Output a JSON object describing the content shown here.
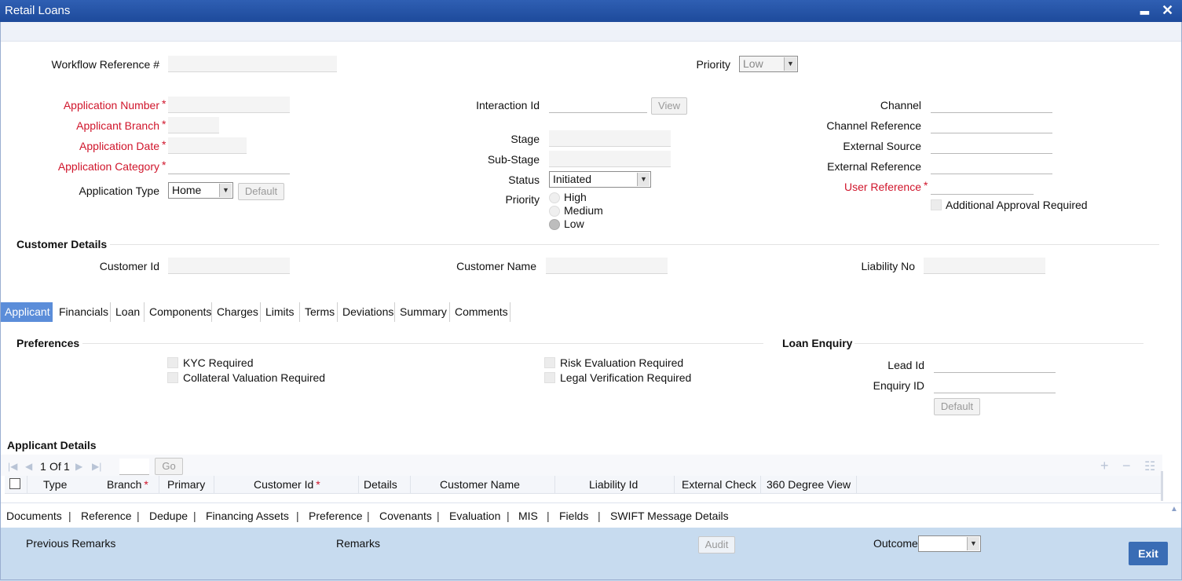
{
  "window": {
    "title": "Retail Loans",
    "minimize": "▂",
    "close": "✕"
  },
  "header": {
    "workflow_ref_label": "Workflow Reference #",
    "workflow_ref_value": "",
    "priority_label": "Priority",
    "priority_value": "Low"
  },
  "left": {
    "app_number_label": "Application Number",
    "applicant_branch_label": "Applicant Branch",
    "application_date_label": "Application Date",
    "application_category_label": "Application Category",
    "application_type_label": "Application Type",
    "application_type_value": "Home",
    "default_button": "Default",
    "required_mark": "*"
  },
  "middle": {
    "interaction_id_label": "Interaction Id",
    "view_button": "View",
    "stage_label": "Stage",
    "substage_label": "Sub-Stage",
    "status_label": "Status",
    "status_value": "Initiated",
    "priority_label": "Priority",
    "priority_options": [
      "High",
      "Medium",
      "Low"
    ],
    "priority_selected": "Low"
  },
  "right": {
    "channel_label": "Channel",
    "channel_ref_label": "Channel Reference",
    "external_source_label": "External Source",
    "external_ref_label": "External Reference",
    "user_ref_label": "User Reference",
    "additional_approval_label": "Additional Approval Required"
  },
  "customer": {
    "section_title": "Customer Details",
    "customer_id_label": "Customer Id",
    "customer_name_label": "Customer Name",
    "liability_no_label": "Liability No"
  },
  "tabs": [
    "Applicant",
    "Financials",
    "Loan",
    "Components",
    "Charges",
    "Limits",
    "Terms",
    "Deviations",
    "Summary",
    "Comments"
  ],
  "active_tab": "Applicant",
  "preferences": {
    "title": "Preferences",
    "kyc": "KYC Required",
    "collateral": "Collateral Valuation Required",
    "risk": "Risk Evaluation Required",
    "legal": "Legal Verification Required"
  },
  "loan_enquiry": {
    "title": "Loan Enquiry",
    "lead_id_label": "Lead Id",
    "enquiry_id_label": "Enquiry ID",
    "default_button": "Default"
  },
  "applicant_details": {
    "title": "Applicant Details",
    "page_current": "1",
    "page_of": "Of",
    "page_total": "1",
    "go_button": "Go",
    "columns": [
      "Type",
      "Branch",
      "Primary",
      "Customer Id",
      "Details",
      "Customer Name",
      "Liability Id",
      "External Check",
      "360 Degree View"
    ],
    "add_icon": "+",
    "remove_icon": "−",
    "list_icon": "☷"
  },
  "bottom_links": [
    "Documents",
    "Reference",
    "Dedupe",
    "Financing Assets",
    "Preference",
    "Covenants",
    "Evaluation",
    "MIS",
    "Fields",
    "SWIFT Message Details"
  ],
  "bottom_sep": "|",
  "footer": {
    "previous_remarks": "Previous Remarks",
    "remarks": "Remarks",
    "audit_button": "Audit",
    "outcome_label": "Outcome",
    "outcome_value": "",
    "exit_button": "Exit"
  },
  "colors": {
    "title_bar": "#1d4a9b",
    "active_tab": "#5b8dd9",
    "required": "#d0152b",
    "footer": "#c7dbef",
    "exit": "#3a6db5"
  }
}
